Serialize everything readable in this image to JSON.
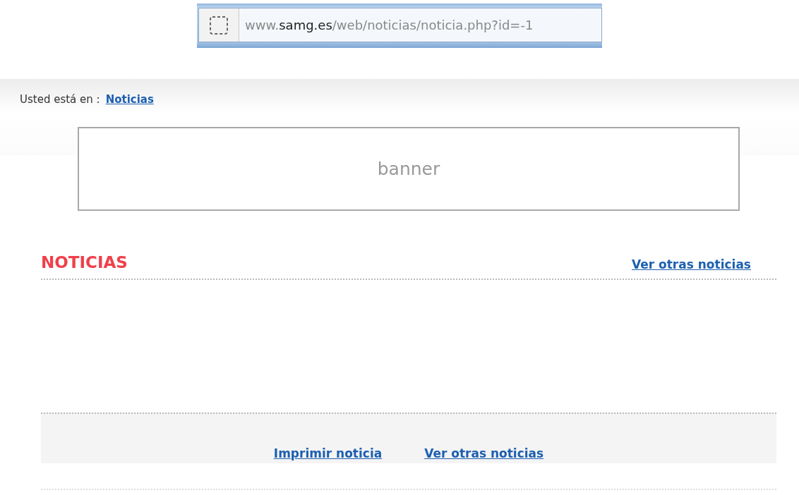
{
  "address_bar": {
    "url": "www.**samg.es**/web/noticias/noticia.php?id=-1"
  },
  "breadcrumb": {
    "label": "Usted está en :",
    "link": "Noticias"
  },
  "banner": {
    "text": "banner"
  },
  "news": {
    "title": "NOTICIAS",
    "link": "Ver otras noticias"
  },
  "footer_links": [
    "Imprimir noticia",
    "Ver otras noticias"
  ]
}
